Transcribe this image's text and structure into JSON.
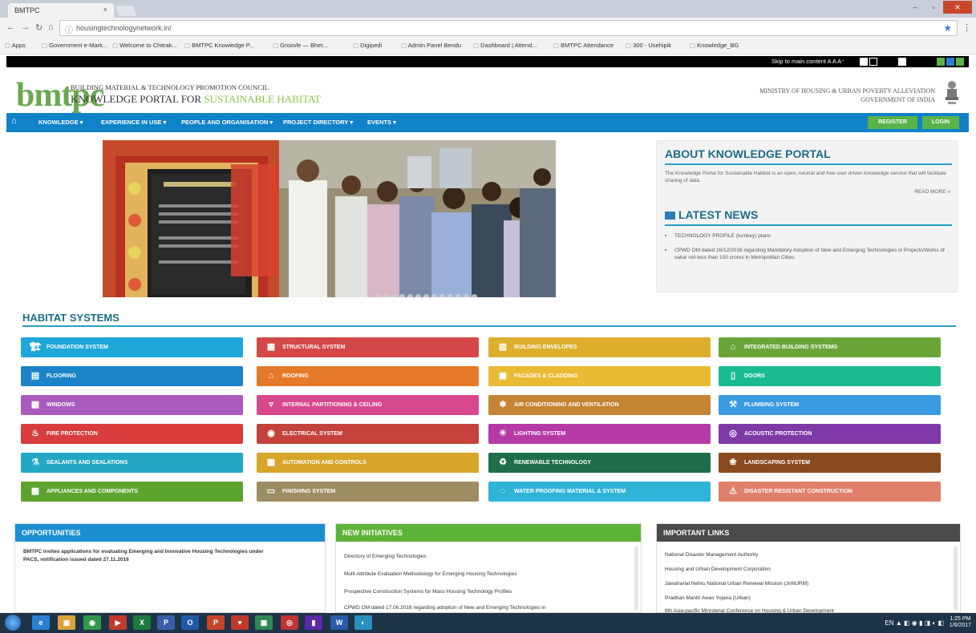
{
  "browser": {
    "tab_title": "BMTPC",
    "tab_close": "×",
    "url": "housingtechnologynetwork.in/",
    "bookmarks": [
      {
        "label": "Apps"
      },
      {
        "label": "Government e-Mark..."
      },
      {
        "label": "Welcome to Chitrak..."
      },
      {
        "label": "BMTPC Knowledge P..."
      },
      {
        "label": "Groovle — Bhet..."
      },
      {
        "label": "Digipedi"
      },
      {
        "label": "Admin Panel Bendu"
      },
      {
        "label": "Dashboard | Attend..."
      },
      {
        "label": "BMTPC Attendance"
      },
      {
        "label": "300 - Usehipik"
      },
      {
        "label": "Knowledge_BG"
      }
    ]
  },
  "site": {
    "skip_text": "Skip to main content  A A A⁺",
    "org_name": "BUILDING MATERIAL & TECHNOLOGY PROMOTION COUNCIL",
    "portal_prefix": "KNOWLEDGE PORTAL FOR ",
    "portal_highlight": "SUSTAINABLE HABITAT",
    "logo": "bmtpc",
    "ministry_line1": "MINISTRY OF HOUSING & URBAN POVERTY ALLEVIATION",
    "ministry_line2": "GOVERNMENT OF INDIA",
    "nav": [
      {
        "label": "KNOWLEDGE ▾"
      },
      {
        "label": "EXPERIENCE IN USE ▾"
      },
      {
        "label": "PEOPLE AND ORGANISATION ▾"
      },
      {
        "label": "PROJECT DIRECTORY ▾"
      },
      {
        "label": "EVENTS ▾"
      }
    ],
    "register_label": "REGISTER",
    "login_label": "LOGIN",
    "slide_count": 13
  },
  "about": {
    "title": "ABOUT KNOWLEDGE PORTAL",
    "text": "The Knowledge Portal for Sustainable Habitat is an open, neutral and free user driven knowledge service that will facilitate sharing of data.",
    "read_more": "READ MORE »"
  },
  "news": {
    "title": "LATEST NEWS",
    "items": [
      {
        "text": "TECHNOLOGY PROFILE (turnkey) plans"
      },
      {
        "text": "CPWD OM dated 28/12/2016 regarding Mandatory Adoption of New and Emerging Technologies in Projects/Works of value not less than 100 crores in Metropolitan Cities."
      }
    ]
  },
  "habitat": {
    "title": "HABITAT SYSTEMS",
    "tiles": [
      {
        "label": "FOUNDATION SYSTEM",
        "color": "#1ea7d8",
        "icon": "🏗"
      },
      {
        "label": "STRUCTURAL SYSTEM",
        "color": "#d4484a",
        "icon": "▦"
      },
      {
        "label": "BUILDING ENVELOPES",
        "color": "#dcae2c",
        "icon": "▥"
      },
      {
        "label": "INTEGRATED BUILDING SYSTEMS",
        "color": "#6ba53a",
        "icon": "⌂"
      },
      {
        "label": "FLOORING",
        "color": "#1b84c8",
        "icon": "▤"
      },
      {
        "label": "ROOFING",
        "color": "#e57a2a",
        "icon": "⌂"
      },
      {
        "label": "FACADES & CLADDING",
        "color": "#e9bb33",
        "icon": "▣"
      },
      {
        "label": "DOORS",
        "color": "#1abb8f",
        "icon": "▯"
      },
      {
        "label": "WINDOWS",
        "color": "#a85bbd",
        "icon": "▦"
      },
      {
        "label": "INTERNAL PARTITIONING & CEILING",
        "color": "#d8488c",
        "icon": "▿"
      },
      {
        "label": "AIR CONDITIONING AND VENTILATION",
        "color": "#c48433",
        "icon": "❄"
      },
      {
        "label": "PLUMBING SYSTEM",
        "color": "#3a9be0",
        "icon": "⚒"
      },
      {
        "label": "FIRE PROTECTION",
        "color": "#d83c3c",
        "icon": "♨"
      },
      {
        "label": "ELECTRICAL SYSTEM",
        "color": "#c5413b",
        "icon": "◉"
      },
      {
        "label": "LIGHTING SYSTEM",
        "color": "#b53aa5",
        "icon": "☀"
      },
      {
        "label": "ACOUSTIC PROTECTION",
        "color": "#7f3aa8",
        "icon": "◎"
      },
      {
        "label": "SEALANTS AND SEALATIONS",
        "color": "#23a7c4",
        "icon": "⚗"
      },
      {
        "label": "AUTOMATION AND CONTROLS",
        "color": "#d6a529",
        "icon": "▦"
      },
      {
        "label": "RENEWABLE TECHNOLOGY",
        "color": "#1e6e4a",
        "icon": "♻"
      },
      {
        "label": "LANDSCAPING SYSTEM",
        "color": "#8a4a1f",
        "icon": "❀"
      },
      {
        "label": "APPLIANCES AND COMPONENTS",
        "color": "#5da32f",
        "icon": "▩"
      },
      {
        "label": "FINISHING SYSTEM",
        "color": "#9c8d62",
        "icon": "▭"
      },
      {
        "label": "WATER PROOFING MATERIAL & SYSTEM",
        "color": "#2fb4d8",
        "icon": "◌"
      },
      {
        "label": "DISASTER RESISTANT CONSTRUCTION",
        "color": "#e0806a",
        "icon": "⚠"
      }
    ]
  },
  "panels": {
    "opportunities": {
      "title": "OPPORTUNITIES",
      "items": [
        {
          "text": "BMTPC invites applications for evaluating Emerging and Innovative Housing Technologies under"
        },
        {
          "text": "PACS, notification issued dated 27.11.2016"
        }
      ]
    },
    "initiatives": {
      "title": "NEW INITIATIVES",
      "items": [
        {
          "text": "Directory of Emerging Technologies"
        },
        {
          "text": "Multi-Attribute Evaluation Methodology for Emerging Housing Technologies"
        },
        {
          "text": "Prospective Construction Systems for Mass Housing Technology Profiles"
        },
        {
          "text": "CPWD OM dated 17.06.2016 regarding adoption of New and Emerging Technologies in"
        }
      ]
    },
    "links": {
      "title": "IMPORTANT LINKS",
      "items": [
        {
          "text": "National Disaster Management Authority"
        },
        {
          "text": "Housing and Urban Development Corporation"
        },
        {
          "text": "Jawaharlal Nehru National Urban Renewal Mission (JnNURM)"
        },
        {
          "text": "Pradhan Mantri Awas Yojana (Urban)"
        },
        {
          "text": "6th Asia-pacific Ministerial Conference on Housing & Urban Development"
        }
      ]
    }
  },
  "taskbar": {
    "apps": [
      {
        "label": "e",
        "color": "#2a7fd4"
      },
      {
        "label": "▣",
        "color": "#d9a43a"
      },
      {
        "label": "◉",
        "color": "#2e9a4a"
      },
      {
        "label": "▶",
        "color": "#c0392b"
      },
      {
        "label": "X",
        "color": "#1e7a3a"
      },
      {
        "label": "P",
        "color": "#3a5fa8"
      },
      {
        "label": "O",
        "color": "#1e5aa8"
      },
      {
        "label": "P",
        "color": "#c7442c"
      },
      {
        "label": "♥",
        "color": "#c0392b"
      },
      {
        "label": "▦",
        "color": "#2e8a55"
      },
      {
        "label": "◎",
        "color": "#c03434"
      },
      {
        "label": "▮",
        "color": "#5a2aa8"
      },
      {
        "label": "W",
        "color": "#2a5aa8"
      },
      {
        "label": "◐",
        "color": "#2a8fc0"
      }
    ],
    "tray": "EN ▲ ◧ ◉ ▮ ◨ ◐ ◧",
    "time": "1:25 PM",
    "date": "1/6/2017"
  }
}
